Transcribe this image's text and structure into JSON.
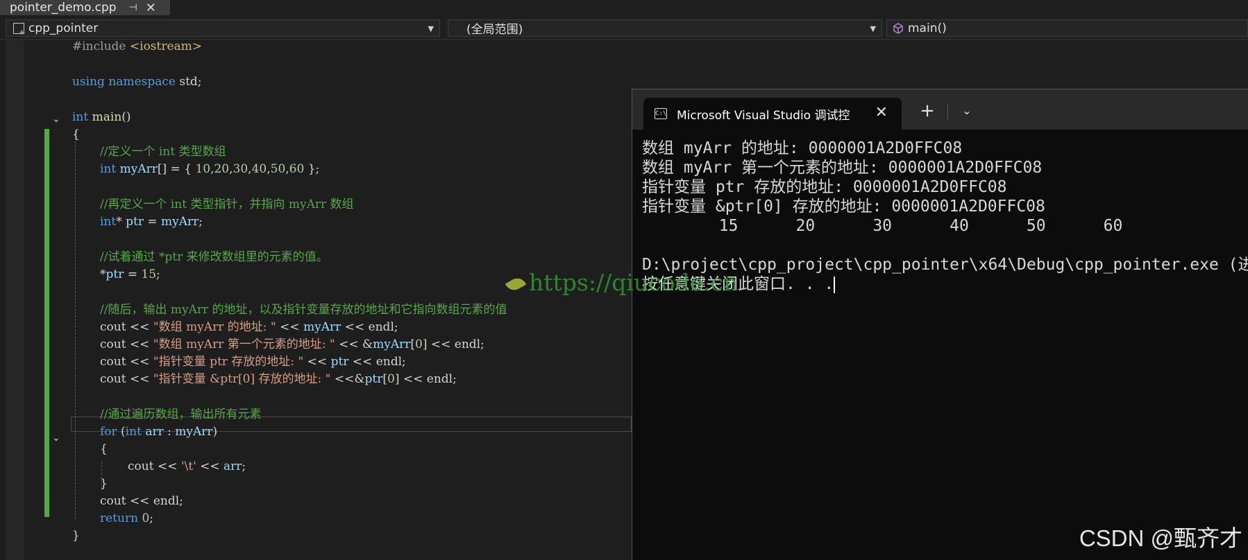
{
  "tab": {
    "filename": "pointer_demo.cpp",
    "pin_glyph": "⊣",
    "close_glyph": "✕"
  },
  "navbar": {
    "project": "cpp_pointer",
    "scope": "(全局范围)",
    "member": "main()"
  },
  "terminal": {
    "title": "Microsoft Visual Studio 调试控",
    "lines": [
      "数组 myArr 的地址: 0000001A2D0FFC08",
      "数组 myArr 第一个元素的地址: 0000001A2D0FFC08",
      "指针变量 ptr 存放的地址: 0000001A2D0FFC08",
      "指针变量 &ptr[0] 存放的地址: 0000001A2D0FFC08",
      "        15      20      30      40      50      60",
      "",
      "D:\\project\\cpp_project\\cpp_pointer\\x64\\Debug\\cpp_pointer.exe (进",
      "按任意键关闭此窗口. . ."
    ]
  },
  "watermark": "https://qiucode.cn",
  "csdn_badge": "CSDN @甄齐才"
}
